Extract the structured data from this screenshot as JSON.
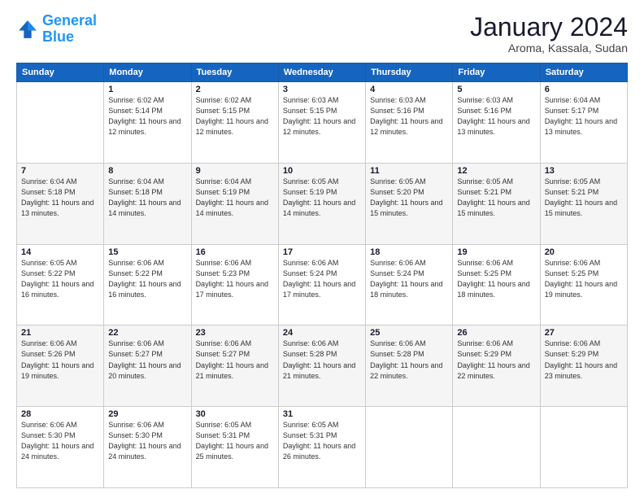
{
  "logo": {
    "text_general": "General",
    "text_blue": "Blue"
  },
  "header": {
    "title": "January 2024",
    "subtitle": "Aroma, Kassala, Sudan"
  },
  "days_of_week": [
    "Sunday",
    "Monday",
    "Tuesday",
    "Wednesday",
    "Thursday",
    "Friday",
    "Saturday"
  ],
  "weeks": [
    [
      {
        "day": "",
        "sunrise": "",
        "sunset": "",
        "daylight": ""
      },
      {
        "day": "1",
        "sunrise": "Sunrise: 6:02 AM",
        "sunset": "Sunset: 5:14 PM",
        "daylight": "Daylight: 11 hours and 12 minutes."
      },
      {
        "day": "2",
        "sunrise": "Sunrise: 6:02 AM",
        "sunset": "Sunset: 5:15 PM",
        "daylight": "Daylight: 11 hours and 12 minutes."
      },
      {
        "day": "3",
        "sunrise": "Sunrise: 6:03 AM",
        "sunset": "Sunset: 5:15 PM",
        "daylight": "Daylight: 11 hours and 12 minutes."
      },
      {
        "day": "4",
        "sunrise": "Sunrise: 6:03 AM",
        "sunset": "Sunset: 5:16 PM",
        "daylight": "Daylight: 11 hours and 12 minutes."
      },
      {
        "day": "5",
        "sunrise": "Sunrise: 6:03 AM",
        "sunset": "Sunset: 5:16 PM",
        "daylight": "Daylight: 11 hours and 13 minutes."
      },
      {
        "day": "6",
        "sunrise": "Sunrise: 6:04 AM",
        "sunset": "Sunset: 5:17 PM",
        "daylight": "Daylight: 11 hours and 13 minutes."
      }
    ],
    [
      {
        "day": "7",
        "sunrise": "Sunrise: 6:04 AM",
        "sunset": "Sunset: 5:18 PM",
        "daylight": "Daylight: 11 hours and 13 minutes."
      },
      {
        "day": "8",
        "sunrise": "Sunrise: 6:04 AM",
        "sunset": "Sunset: 5:18 PM",
        "daylight": "Daylight: 11 hours and 14 minutes."
      },
      {
        "day": "9",
        "sunrise": "Sunrise: 6:04 AM",
        "sunset": "Sunset: 5:19 PM",
        "daylight": "Daylight: 11 hours and 14 minutes."
      },
      {
        "day": "10",
        "sunrise": "Sunrise: 6:05 AM",
        "sunset": "Sunset: 5:19 PM",
        "daylight": "Daylight: 11 hours and 14 minutes."
      },
      {
        "day": "11",
        "sunrise": "Sunrise: 6:05 AM",
        "sunset": "Sunset: 5:20 PM",
        "daylight": "Daylight: 11 hours and 15 minutes."
      },
      {
        "day": "12",
        "sunrise": "Sunrise: 6:05 AM",
        "sunset": "Sunset: 5:21 PM",
        "daylight": "Daylight: 11 hours and 15 minutes."
      },
      {
        "day": "13",
        "sunrise": "Sunrise: 6:05 AM",
        "sunset": "Sunset: 5:21 PM",
        "daylight": "Daylight: 11 hours and 15 minutes."
      }
    ],
    [
      {
        "day": "14",
        "sunrise": "Sunrise: 6:05 AM",
        "sunset": "Sunset: 5:22 PM",
        "daylight": "Daylight: 11 hours and 16 minutes."
      },
      {
        "day": "15",
        "sunrise": "Sunrise: 6:06 AM",
        "sunset": "Sunset: 5:22 PM",
        "daylight": "Daylight: 11 hours and 16 minutes."
      },
      {
        "day": "16",
        "sunrise": "Sunrise: 6:06 AM",
        "sunset": "Sunset: 5:23 PM",
        "daylight": "Daylight: 11 hours and 17 minutes."
      },
      {
        "day": "17",
        "sunrise": "Sunrise: 6:06 AM",
        "sunset": "Sunset: 5:24 PM",
        "daylight": "Daylight: 11 hours and 17 minutes."
      },
      {
        "day": "18",
        "sunrise": "Sunrise: 6:06 AM",
        "sunset": "Sunset: 5:24 PM",
        "daylight": "Daylight: 11 hours and 18 minutes."
      },
      {
        "day": "19",
        "sunrise": "Sunrise: 6:06 AM",
        "sunset": "Sunset: 5:25 PM",
        "daylight": "Daylight: 11 hours and 18 minutes."
      },
      {
        "day": "20",
        "sunrise": "Sunrise: 6:06 AM",
        "sunset": "Sunset: 5:25 PM",
        "daylight": "Daylight: 11 hours and 19 minutes."
      }
    ],
    [
      {
        "day": "21",
        "sunrise": "Sunrise: 6:06 AM",
        "sunset": "Sunset: 5:26 PM",
        "daylight": "Daylight: 11 hours and 19 minutes."
      },
      {
        "day": "22",
        "sunrise": "Sunrise: 6:06 AM",
        "sunset": "Sunset: 5:27 PM",
        "daylight": "Daylight: 11 hours and 20 minutes."
      },
      {
        "day": "23",
        "sunrise": "Sunrise: 6:06 AM",
        "sunset": "Sunset: 5:27 PM",
        "daylight": "Daylight: 11 hours and 21 minutes."
      },
      {
        "day": "24",
        "sunrise": "Sunrise: 6:06 AM",
        "sunset": "Sunset: 5:28 PM",
        "daylight": "Daylight: 11 hours and 21 minutes."
      },
      {
        "day": "25",
        "sunrise": "Sunrise: 6:06 AM",
        "sunset": "Sunset: 5:28 PM",
        "daylight": "Daylight: 11 hours and 22 minutes."
      },
      {
        "day": "26",
        "sunrise": "Sunrise: 6:06 AM",
        "sunset": "Sunset: 5:29 PM",
        "daylight": "Daylight: 11 hours and 22 minutes."
      },
      {
        "day": "27",
        "sunrise": "Sunrise: 6:06 AM",
        "sunset": "Sunset: 5:29 PM",
        "daylight": "Daylight: 11 hours and 23 minutes."
      }
    ],
    [
      {
        "day": "28",
        "sunrise": "Sunrise: 6:06 AM",
        "sunset": "Sunset: 5:30 PM",
        "daylight": "Daylight: 11 hours and 24 minutes."
      },
      {
        "day": "29",
        "sunrise": "Sunrise: 6:06 AM",
        "sunset": "Sunset: 5:30 PM",
        "daylight": "Daylight: 11 hours and 24 minutes."
      },
      {
        "day": "30",
        "sunrise": "Sunrise: 6:05 AM",
        "sunset": "Sunset: 5:31 PM",
        "daylight": "Daylight: 11 hours and 25 minutes."
      },
      {
        "day": "31",
        "sunrise": "Sunrise: 6:05 AM",
        "sunset": "Sunset: 5:31 PM",
        "daylight": "Daylight: 11 hours and 26 minutes."
      },
      {
        "day": "",
        "sunrise": "",
        "sunset": "",
        "daylight": ""
      },
      {
        "day": "",
        "sunrise": "",
        "sunset": "",
        "daylight": ""
      },
      {
        "day": "",
        "sunrise": "",
        "sunset": "",
        "daylight": ""
      }
    ]
  ]
}
